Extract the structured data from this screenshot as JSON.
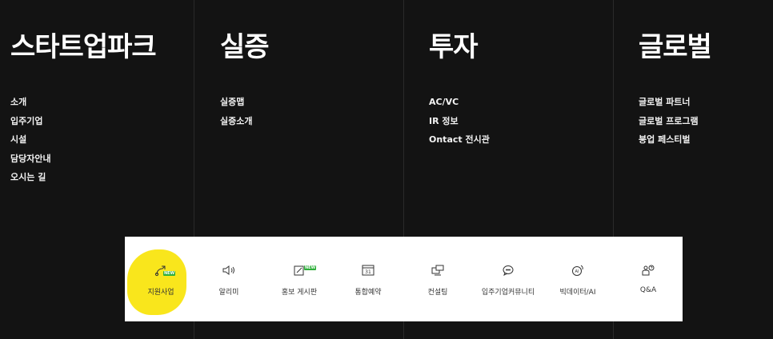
{
  "columns": [
    {
      "title": "스타트업파크",
      "items": [
        "소개",
        "입주기업",
        "시설",
        "담당자안내",
        "오시는 길"
      ]
    },
    {
      "title": "실증",
      "items": [
        "실증맵",
        "실증소개"
      ]
    },
    {
      "title": "투자",
      "items": [
        "AC/VC",
        "IR 정보",
        "Ontact 전시관"
      ]
    },
    {
      "title": "글로벌",
      "items": [
        "글로벌 파트너",
        "글로벌 프로그램",
        "붕업 페스티벌"
      ]
    }
  ],
  "quickbar": {
    "items": [
      {
        "label": "지원사업",
        "icon": "support-icon",
        "badge": "NEW"
      },
      {
        "label": "알리미",
        "icon": "megaphone-icon"
      },
      {
        "label": "홍보 게시판",
        "icon": "edit-board-icon",
        "badge": "NEW"
      },
      {
        "label": "통합예약",
        "icon": "calendar-icon",
        "calendar_day": "31"
      },
      {
        "label": "컨설팅",
        "icon": "consulting-icon"
      },
      {
        "label": "입주기업커뮤니티",
        "icon": "chat-icon"
      },
      {
        "label": "빅데이터/AI",
        "icon": "ai-icon",
        "icon_text": "AI"
      },
      {
        "label": "Q&A",
        "icon": "qna-icon"
      }
    ],
    "highlight_color": "#f9e61c",
    "badge_color": "#2fae3b"
  }
}
